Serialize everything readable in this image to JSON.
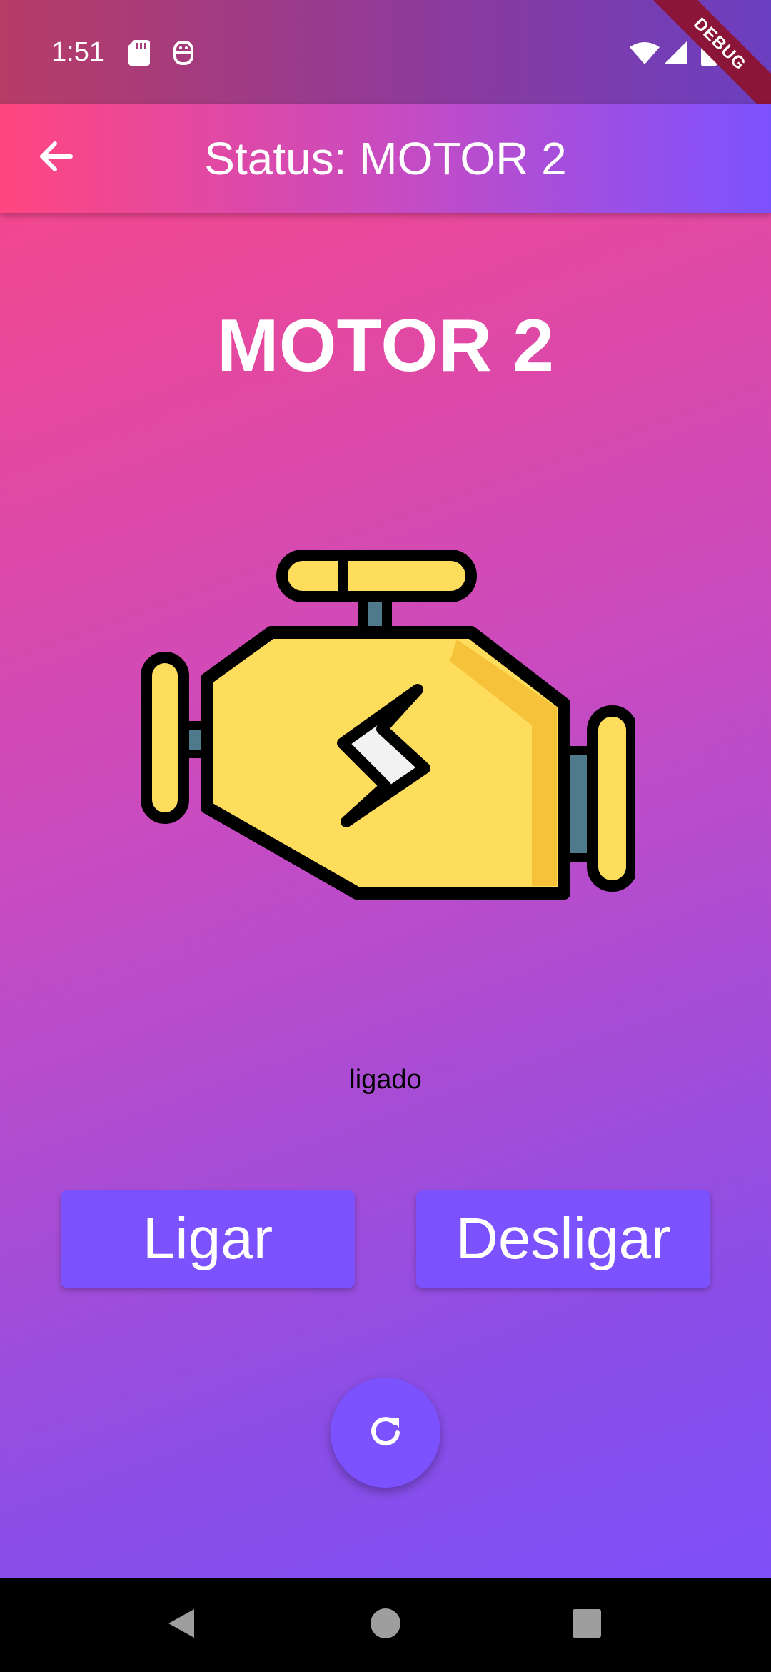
{
  "status_bar": {
    "time": "1:51",
    "debug_label": "DEBUG",
    "icons": [
      "sd-card-icon",
      "notification-icon",
      "wifi-icon",
      "signal-icon",
      "battery-icon"
    ]
  },
  "app_bar": {
    "title": "Status: MOTOR 2",
    "back_icon": "arrow-back-icon"
  },
  "main": {
    "heading": "MOTOR 2",
    "image_icon": "engine-icon",
    "status": "ligado",
    "buttons": {
      "on_label": "Ligar",
      "off_label": "Desligar"
    },
    "fab_icon": "refresh-icon"
  },
  "nav": {
    "icons": [
      "back-triangle-icon",
      "home-circle-icon",
      "recents-square-icon"
    ]
  },
  "colors": {
    "accent": "#7c52ff",
    "gradient_start": "#ff4680",
    "gradient_end": "#7c52ff",
    "engine_body": "#ffdd5c"
  }
}
